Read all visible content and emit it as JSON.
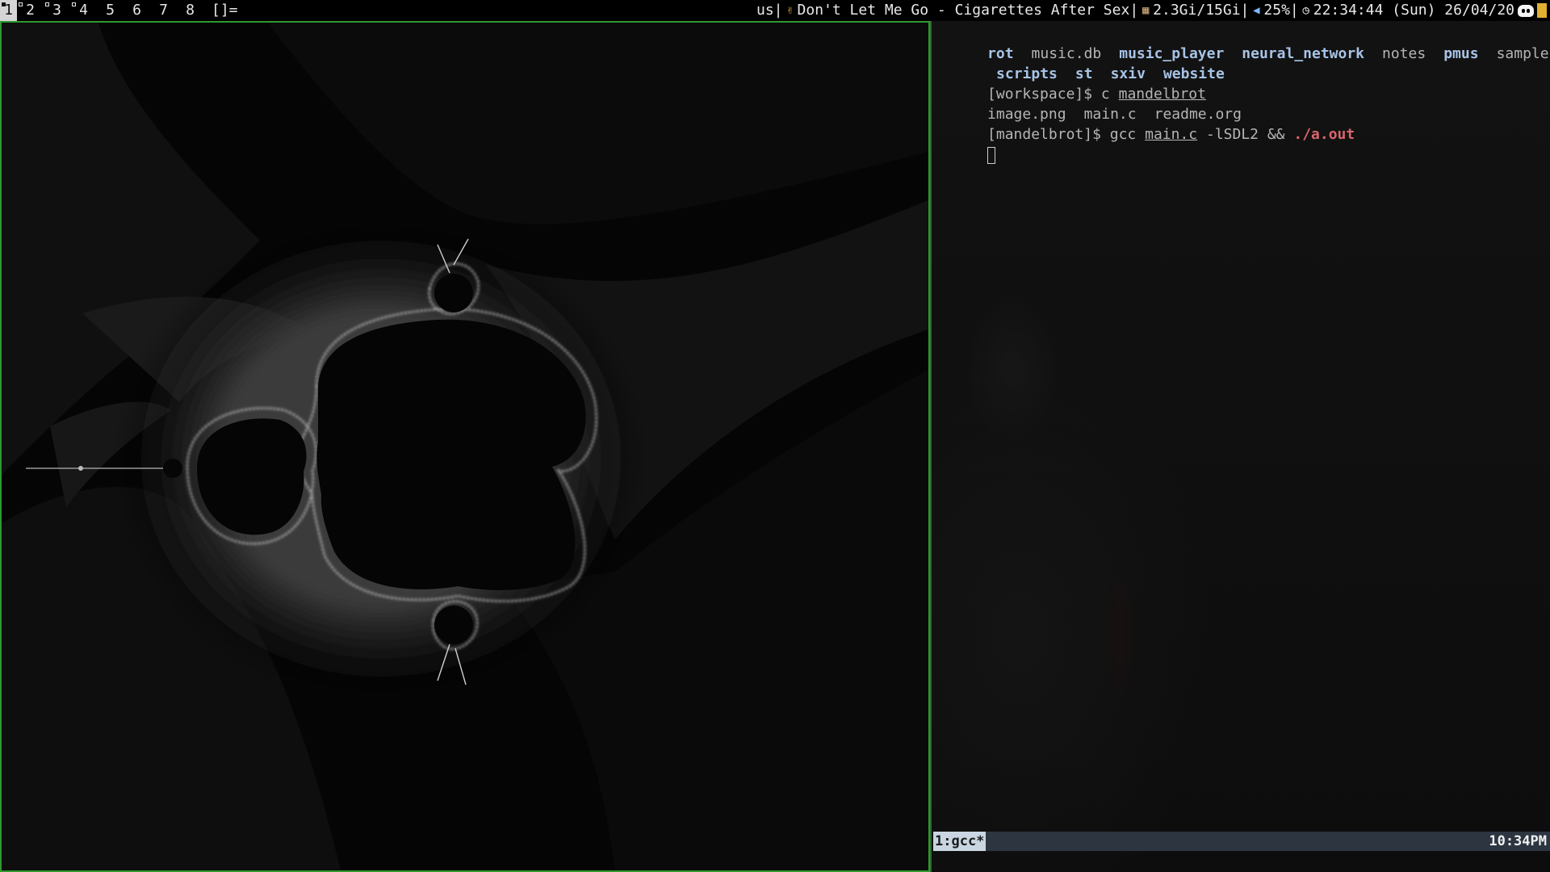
{
  "bar": {
    "tags": [
      "1",
      "2",
      "3",
      "4",
      "5",
      "6",
      "7",
      "8"
    ],
    "selected_tag": "1",
    "occupied_tags": [
      "1",
      "2",
      "3",
      "4"
    ],
    "layout_symbol": "[]=",
    "status": {
      "keyboard": "us",
      "now_playing": "Don't Let Me Go - Cigarettes After Sex",
      "memory": "2.3Gi/15Gi",
      "volume": "25%",
      "clock": "22:34:44 (Sun) 26/04/20",
      "sep": "|"
    },
    "icons": {
      "music": "rock-hand-icon",
      "memory": "ram-icon",
      "volume": "speaker-icon",
      "clock": "clock-icon",
      "discord": "discord-icon",
      "battery": "battery-icon"
    }
  },
  "terminal": {
    "ls_row1": [
      {
        "text": "rot",
        "type": "dir"
      },
      {
        "text": "music.db",
        "type": "file"
      },
      {
        "text": "music_player",
        "type": "dir"
      },
      {
        "text": "neural_network",
        "type": "dir"
      },
      {
        "text": "notes",
        "type": "file"
      },
      {
        "text": "pmus",
        "type": "dir"
      },
      {
        "text": "sample.txt",
        "type": "file"
      }
    ],
    "ls_row2": [
      {
        "text": "scripts",
        "type": "dir"
      },
      {
        "text": "st",
        "type": "dir"
      },
      {
        "text": "sxiv",
        "type": "dir"
      },
      {
        "text": "website",
        "type": "dir"
      }
    ],
    "prompt1": "[workspace]$ ",
    "cmd1_name": "c",
    "cmd1_arg": "mandelbrot",
    "ls2": [
      "image.png",
      "main.c",
      "readme.org"
    ],
    "prompt2": "[mandelbrot]$ ",
    "cmd2_name": "gcc",
    "cmd2_file": "main.c",
    "cmd2_flags": "-lSDL2 &&",
    "cmd2_exec": "./a.out",
    "tmux_window": "1:gcc*",
    "tmux_time": "10:34PM"
  }
}
